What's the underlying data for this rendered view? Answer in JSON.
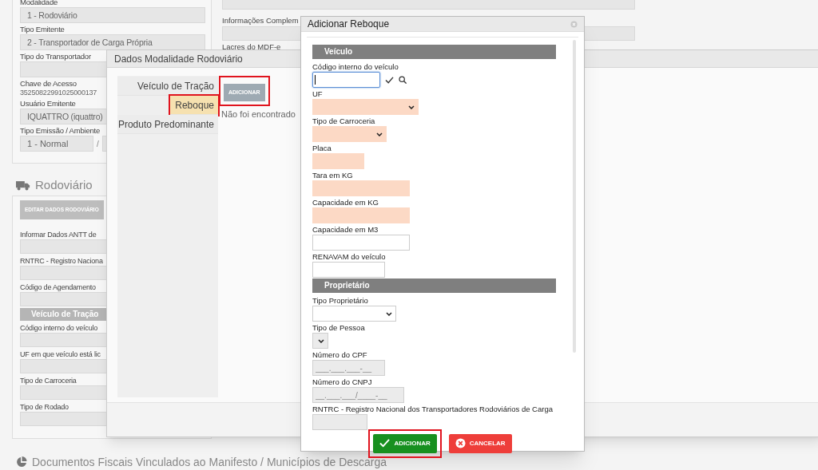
{
  "page": {
    "top_right_fields": [
      {
        "kind": "field"
      },
      {
        "kind": "field",
        "label": "Informações Complem"
      },
      {
        "kind": "label",
        "label": "Lacres do MDF-e"
      }
    ],
    "general_fields": [
      {
        "kind": "field",
        "label": "Modalidade",
        "value": "1 - Rodoviário"
      },
      {
        "kind": "field",
        "label": "Tipo Emitente",
        "value": "2 - Transportador de Carga Própria"
      },
      {
        "kind": "field",
        "label": "Tipo do Transportador"
      },
      {
        "kind": "text",
        "label": "Chave de Acesso",
        "value": "35250822991025000137"
      },
      {
        "kind": "field",
        "label": "Usuário Emitente",
        "value": "IQUATTRO (iquattro)"
      },
      {
        "kind": "pair",
        "label": "Tipo Emissão / Ambiente",
        "value": "1 - Normal",
        "separator": "/"
      }
    ],
    "section_title": "Rodoviário",
    "edit_button": "EDITAR DADOS RODOVIÁRIO",
    "rodoviario_fields": [
      {
        "kind": "field",
        "label": "Informar Dados ANTT de"
      },
      {
        "kind": "field",
        "label": "RNTRC - Registro Naciona"
      },
      {
        "kind": "field",
        "label": "Código de Agendamento"
      },
      {
        "kind": "header",
        "label": "Veículo de Tração"
      },
      {
        "kind": "field",
        "label": "Código interno do veículo"
      },
      {
        "kind": "field",
        "label": "UF em que veículo está lic"
      },
      {
        "kind": "field",
        "label": "Tipo de Carroceria"
      },
      {
        "kind": "field",
        "label": "Tipo de Rodado"
      }
    ],
    "documents_title": "Documentos Fiscais Vinculados ao Manifesto / Municípios de Descarga"
  },
  "modal_dialog": {
    "title": "Dados Modalidade Rodoviário",
    "tabs": [
      {
        "label": "Veículo de Tração",
        "selected": false,
        "highlighted": false
      },
      {
        "label": "Reboque",
        "selected": true,
        "highlighted": true
      },
      {
        "label": "Produto Predominante",
        "selected": false,
        "highlighted": false
      }
    ],
    "add_button": {
      "label": "ADICIONAR",
      "highlighted": true
    },
    "empty_message": "Não foi encontrado"
  },
  "reboque_dialog": {
    "title": "Adicionar Reboque",
    "items": [
      {
        "kind": "section",
        "label": "Veículo"
      },
      {
        "kind": "lookup",
        "label": "Código interno do veículo",
        "focused": true
      },
      {
        "kind": "select",
        "label": "UF",
        "required": true,
        "disabled": false
      },
      {
        "kind": "select",
        "label": "Tipo de Carroceria",
        "required": true,
        "disabled": false
      },
      {
        "kind": "input",
        "label": "Placa",
        "required": true,
        "disabled": false
      },
      {
        "kind": "input",
        "label": "Tara em KG",
        "required": true,
        "disabled": false
      },
      {
        "kind": "input",
        "label": "Capacidade em KG",
        "required": true,
        "disabled": false
      },
      {
        "kind": "input",
        "label": "Capacidade em M3",
        "required": false,
        "disabled": false
      },
      {
        "kind": "input",
        "label": "RENAVAM do veículo",
        "required": false,
        "disabled": false
      },
      {
        "kind": "section",
        "label": "Proprietário"
      },
      {
        "kind": "select",
        "label": "Tipo Proprietário",
        "required": false,
        "disabled": false
      },
      {
        "kind": "select",
        "label": "Tipo de Pessoa",
        "disabled": true
      },
      {
        "kind": "input",
        "label": "Número do CPF",
        "disabled": true,
        "placeholder": "___.___.___-__"
      },
      {
        "kind": "input",
        "label": "Número do CNPJ",
        "disabled": true,
        "placeholder": "__.___.___/____-__"
      },
      {
        "kind": "input",
        "label": "RNTRC - Registro Nacional dos Transportadores Rodoviários de Carga",
        "disabled": true
      }
    ],
    "buttons": [
      {
        "kind": "confirm",
        "label": "ADICIONAR",
        "highlighted": true
      },
      {
        "kind": "cancel",
        "label": "CANCELAR",
        "highlighted": false
      }
    ]
  }
}
